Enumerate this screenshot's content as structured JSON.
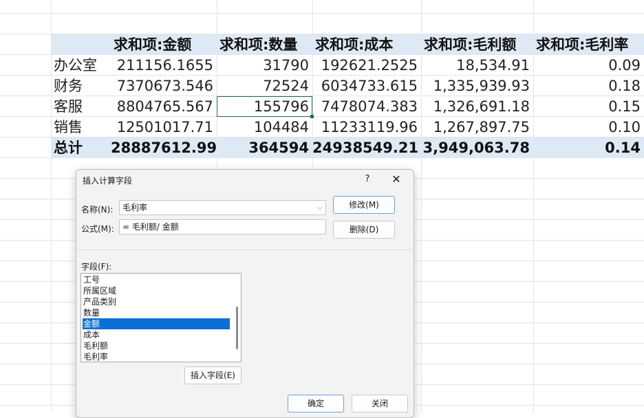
{
  "pivot": {
    "headers": [
      "求和项:金额",
      "求和项:数量",
      "求和项:成本",
      "求和项:毛利额",
      "求和项:毛利率"
    ],
    "rows": [
      {
        "label": "办公室",
        "amount": "211156.1655",
        "qty": "31790",
        "cost": "192621.2525",
        "profit": "18,534.91",
        "margin": "0.09"
      },
      {
        "label": "财务",
        "amount": "7370673.546",
        "qty": "72524",
        "cost": "6034733.615",
        "profit": "1,335,939.93",
        "margin": "0.18"
      },
      {
        "label": "客服",
        "amount": "8804765.567",
        "qty": "155796",
        "cost": "7478074.383",
        "profit": "1,326,691.18",
        "margin": "0.15"
      },
      {
        "label": "销售",
        "amount": "12501017.71",
        "qty": "104484",
        "cost": "11233119.96",
        "profit": "1,267,897.75",
        "margin": "0.10"
      }
    ],
    "total": {
      "label": "总计",
      "amount": "28887612.99",
      "qty": "364594",
      "cost": "24938549.21",
      "profit": "3,949,063.78",
      "margin": "0.14"
    }
  },
  "dialog": {
    "title": "插入计算字段",
    "help": "?",
    "close": "✕",
    "name_label": "名称(N):",
    "name_value": "毛利率",
    "formula_label": "公式(M):",
    "formula_value": "= 毛利额/ 金额",
    "modify_button": "修改(M)",
    "delete_button": "删除(D)",
    "fields_label": "字段(F):",
    "fields": [
      "工号",
      "所属区域",
      "产品类别",
      "数量",
      "金额",
      "成本",
      "毛利额",
      "毛利率"
    ],
    "selected_field": "金额",
    "insert_button": "插入字段(E)",
    "ok_button": "确定",
    "close_button": "关闭"
  }
}
